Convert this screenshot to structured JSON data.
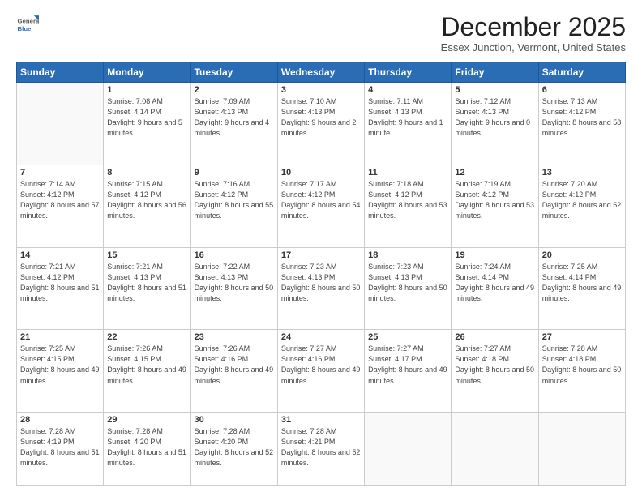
{
  "header": {
    "logo": {
      "general": "General",
      "blue": "Blue"
    },
    "title": "December 2025",
    "location": "Essex Junction, Vermont, United States"
  },
  "weekdays": [
    "Sunday",
    "Monday",
    "Tuesday",
    "Wednesday",
    "Thursday",
    "Friday",
    "Saturday"
  ],
  "weeks": [
    [
      {
        "day": "",
        "sunrise": "",
        "sunset": "",
        "daylight": ""
      },
      {
        "day": "1",
        "sunrise": "Sunrise: 7:08 AM",
        "sunset": "Sunset: 4:14 PM",
        "daylight": "Daylight: 9 hours and 5 minutes."
      },
      {
        "day": "2",
        "sunrise": "Sunrise: 7:09 AM",
        "sunset": "Sunset: 4:13 PM",
        "daylight": "Daylight: 9 hours and 4 minutes."
      },
      {
        "day": "3",
        "sunrise": "Sunrise: 7:10 AM",
        "sunset": "Sunset: 4:13 PM",
        "daylight": "Daylight: 9 hours and 2 minutes."
      },
      {
        "day": "4",
        "sunrise": "Sunrise: 7:11 AM",
        "sunset": "Sunset: 4:13 PM",
        "daylight": "Daylight: 9 hours and 1 minute."
      },
      {
        "day": "5",
        "sunrise": "Sunrise: 7:12 AM",
        "sunset": "Sunset: 4:13 PM",
        "daylight": "Daylight: 9 hours and 0 minutes."
      },
      {
        "day": "6",
        "sunrise": "Sunrise: 7:13 AM",
        "sunset": "Sunset: 4:12 PM",
        "daylight": "Daylight: 8 hours and 58 minutes."
      }
    ],
    [
      {
        "day": "7",
        "sunrise": "Sunrise: 7:14 AM",
        "sunset": "Sunset: 4:12 PM",
        "daylight": "Daylight: 8 hours and 57 minutes."
      },
      {
        "day": "8",
        "sunrise": "Sunrise: 7:15 AM",
        "sunset": "Sunset: 4:12 PM",
        "daylight": "Daylight: 8 hours and 56 minutes."
      },
      {
        "day": "9",
        "sunrise": "Sunrise: 7:16 AM",
        "sunset": "Sunset: 4:12 PM",
        "daylight": "Daylight: 8 hours and 55 minutes."
      },
      {
        "day": "10",
        "sunrise": "Sunrise: 7:17 AM",
        "sunset": "Sunset: 4:12 PM",
        "daylight": "Daylight: 8 hours and 54 minutes."
      },
      {
        "day": "11",
        "sunrise": "Sunrise: 7:18 AM",
        "sunset": "Sunset: 4:12 PM",
        "daylight": "Daylight: 8 hours and 53 minutes."
      },
      {
        "day": "12",
        "sunrise": "Sunrise: 7:19 AM",
        "sunset": "Sunset: 4:12 PM",
        "daylight": "Daylight: 8 hours and 53 minutes."
      },
      {
        "day": "13",
        "sunrise": "Sunrise: 7:20 AM",
        "sunset": "Sunset: 4:12 PM",
        "daylight": "Daylight: 8 hours and 52 minutes."
      }
    ],
    [
      {
        "day": "14",
        "sunrise": "Sunrise: 7:21 AM",
        "sunset": "Sunset: 4:12 PM",
        "daylight": "Daylight: 8 hours and 51 minutes."
      },
      {
        "day": "15",
        "sunrise": "Sunrise: 7:21 AM",
        "sunset": "Sunset: 4:13 PM",
        "daylight": "Daylight: 8 hours and 51 minutes."
      },
      {
        "day": "16",
        "sunrise": "Sunrise: 7:22 AM",
        "sunset": "Sunset: 4:13 PM",
        "daylight": "Daylight: 8 hours and 50 minutes."
      },
      {
        "day": "17",
        "sunrise": "Sunrise: 7:23 AM",
        "sunset": "Sunset: 4:13 PM",
        "daylight": "Daylight: 8 hours and 50 minutes."
      },
      {
        "day": "18",
        "sunrise": "Sunrise: 7:23 AM",
        "sunset": "Sunset: 4:13 PM",
        "daylight": "Daylight: 8 hours and 50 minutes."
      },
      {
        "day": "19",
        "sunrise": "Sunrise: 7:24 AM",
        "sunset": "Sunset: 4:14 PM",
        "daylight": "Daylight: 8 hours and 49 minutes."
      },
      {
        "day": "20",
        "sunrise": "Sunrise: 7:25 AM",
        "sunset": "Sunset: 4:14 PM",
        "daylight": "Daylight: 8 hours and 49 minutes."
      }
    ],
    [
      {
        "day": "21",
        "sunrise": "Sunrise: 7:25 AM",
        "sunset": "Sunset: 4:15 PM",
        "daylight": "Daylight: 8 hours and 49 minutes."
      },
      {
        "day": "22",
        "sunrise": "Sunrise: 7:26 AM",
        "sunset": "Sunset: 4:15 PM",
        "daylight": "Daylight: 8 hours and 49 minutes."
      },
      {
        "day": "23",
        "sunrise": "Sunrise: 7:26 AM",
        "sunset": "Sunset: 4:16 PM",
        "daylight": "Daylight: 8 hours and 49 minutes."
      },
      {
        "day": "24",
        "sunrise": "Sunrise: 7:27 AM",
        "sunset": "Sunset: 4:16 PM",
        "daylight": "Daylight: 8 hours and 49 minutes."
      },
      {
        "day": "25",
        "sunrise": "Sunrise: 7:27 AM",
        "sunset": "Sunset: 4:17 PM",
        "daylight": "Daylight: 8 hours and 49 minutes."
      },
      {
        "day": "26",
        "sunrise": "Sunrise: 7:27 AM",
        "sunset": "Sunset: 4:18 PM",
        "daylight": "Daylight: 8 hours and 50 minutes."
      },
      {
        "day": "27",
        "sunrise": "Sunrise: 7:28 AM",
        "sunset": "Sunset: 4:18 PM",
        "daylight": "Daylight: 8 hours and 50 minutes."
      }
    ],
    [
      {
        "day": "28",
        "sunrise": "Sunrise: 7:28 AM",
        "sunset": "Sunset: 4:19 PM",
        "daylight": "Daylight: 8 hours and 51 minutes."
      },
      {
        "day": "29",
        "sunrise": "Sunrise: 7:28 AM",
        "sunset": "Sunset: 4:20 PM",
        "daylight": "Daylight: 8 hours and 51 minutes."
      },
      {
        "day": "30",
        "sunrise": "Sunrise: 7:28 AM",
        "sunset": "Sunset: 4:20 PM",
        "daylight": "Daylight: 8 hours and 52 minutes."
      },
      {
        "day": "31",
        "sunrise": "Sunrise: 7:28 AM",
        "sunset": "Sunset: 4:21 PM",
        "daylight": "Daylight: 8 hours and 52 minutes."
      },
      {
        "day": "",
        "sunrise": "",
        "sunset": "",
        "daylight": ""
      },
      {
        "day": "",
        "sunrise": "",
        "sunset": "",
        "daylight": ""
      },
      {
        "day": "",
        "sunrise": "",
        "sunset": "",
        "daylight": ""
      }
    ]
  ]
}
